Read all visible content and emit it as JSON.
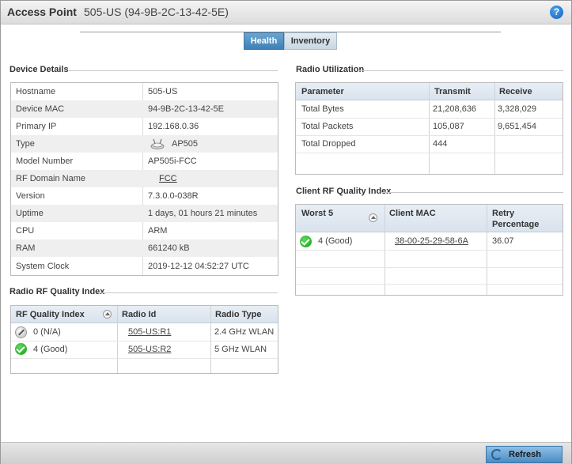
{
  "header": {
    "title": "Access Point",
    "subtitle": "505-US (94-9B-2C-13-42-5E)",
    "help": "?"
  },
  "tabs": [
    {
      "label": "Health",
      "active": true
    },
    {
      "label": "Inventory",
      "active": false
    }
  ],
  "device_details": {
    "title": "Device Details",
    "rows": [
      {
        "key": "Hostname",
        "value": "505-US"
      },
      {
        "key": "Device MAC",
        "value": "94-9B-2C-13-42-5E"
      },
      {
        "key": "Primary IP",
        "value": "192.168.0.36"
      },
      {
        "key": "Type",
        "value": "AP505",
        "icon": "access-point-icon"
      },
      {
        "key": "Model Number",
        "value": "AP505i-FCC"
      },
      {
        "key": "RF Domain Name",
        "value": "FCC",
        "link": true
      },
      {
        "key": "Version",
        "value": "7.3.0.0-038R"
      },
      {
        "key": "Uptime",
        "value": "1 days, 01 hours 21 minutes"
      },
      {
        "key": "CPU",
        "value": "ARM"
      },
      {
        "key": "RAM",
        "value": "661240 kB"
      },
      {
        "key": "System Clock",
        "value": "2019-12-12 04:52:27 UTC"
      }
    ]
  },
  "radio_rf_quality": {
    "title": "Radio RF Quality Index",
    "columns": [
      "RF Quality Index",
      "Radio Id",
      "Radio Type"
    ],
    "rows": [
      {
        "quality": "0 (N/A)",
        "status_icon": "status-na-icon",
        "radio_id": "505-US:R1",
        "radio_type": "2.4 GHz WLAN"
      },
      {
        "quality": "4 (Good)",
        "status_icon": "status-good-icon",
        "radio_id": "505-US:R2",
        "radio_type": "5 GHz WLAN"
      }
    ]
  },
  "radio_utilization": {
    "title": "Radio Utilization",
    "columns": [
      "Parameter",
      "Transmit",
      "Receive"
    ],
    "rows": [
      {
        "parameter": "Total Bytes",
        "transmit": "21,208,636",
        "receive": "3,328,029"
      },
      {
        "parameter": "Total Packets",
        "transmit": "105,087",
        "receive": "9,651,454"
      },
      {
        "parameter": "Total Dropped",
        "transmit": "444",
        "receive": ""
      }
    ]
  },
  "client_rf_quality": {
    "title": "Client RF Quality Index",
    "columns": [
      "Worst 5",
      "Client MAC",
      "Retry Percentage"
    ],
    "retry_line1": "Retry",
    "retry_line2": "Percentage",
    "rows": [
      {
        "quality": "4 (Good)",
        "status_icon": "status-good-icon",
        "client_mac": "38-00-25-29-58-6A",
        "retry": "36.07"
      }
    ]
  },
  "footer": {
    "refresh_label": "Refresh"
  },
  "colors": {
    "tab_active": "#3e80b7",
    "status_good": "#14a014",
    "header_grid": "#d9e3ee"
  }
}
